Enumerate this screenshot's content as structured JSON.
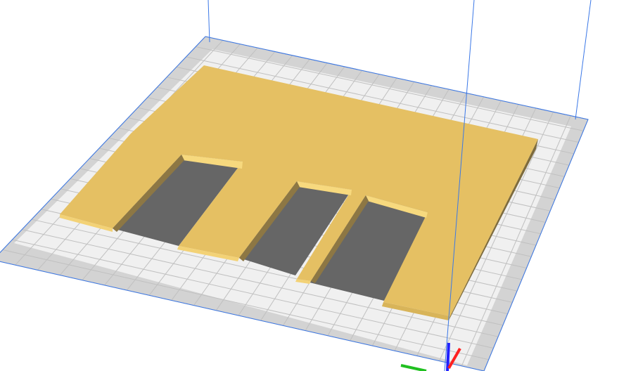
{
  "app": {
    "view": "3d-build-plate-preview",
    "colors": {
      "background": "#ffffff",
      "plate_outer": "#d2d2d2",
      "plate_border": "#a9a9a9",
      "plate_inner": "#efefef",
      "grid_line": "#bdbdbd",
      "grid_line_dark": "#4c4c4c",
      "volume_line": "#2f6fe0",
      "model_top": "#e6c062",
      "model_edge_light": "#f6d67a",
      "model_side": "#8a7440",
      "slot_floor": "#666666",
      "axis_x": "#ff2020",
      "axis_y": "#20c020",
      "axis_z": "#2020ff"
    }
  },
  "scene_objects": {
    "build_plate": "build-plate",
    "build_volume": "build-volume-outline",
    "model": "printed-model-plate-with-slots",
    "axes": [
      "axis-x",
      "axis-y",
      "axis-z"
    ]
  }
}
